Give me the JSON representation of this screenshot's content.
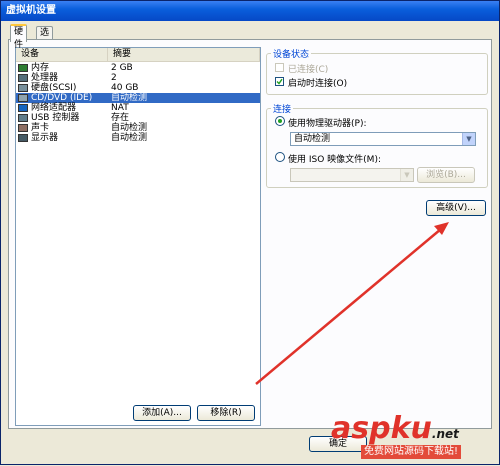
{
  "window": {
    "title": "虚拟机设置"
  },
  "tabs": [
    {
      "label": "硬件",
      "active": true
    },
    {
      "label": "选项",
      "active": false
    }
  ],
  "device_list": {
    "columns": [
      "设备",
      "摘要"
    ],
    "rows": [
      {
        "device": "内存",
        "summary": "2 GB",
        "icon": "memory-icon"
      },
      {
        "device": "处理器",
        "summary": "2",
        "icon": "processor-icon"
      },
      {
        "device": "硬盘(SCSI)",
        "summary": "40 GB",
        "icon": "hard-disk-icon"
      },
      {
        "device": "CD/DVD (IDE)",
        "summary": "自动检测",
        "icon": "cd-dvd-icon",
        "selected": true
      },
      {
        "device": "网络适配器",
        "summary": "NAT",
        "icon": "network-adapter-icon"
      },
      {
        "device": "USB 控制器",
        "summary": "存在",
        "icon": "usb-controller-icon"
      },
      {
        "device": "声卡",
        "summary": "自动检测",
        "icon": "sound-card-icon"
      },
      {
        "device": "显示器",
        "summary": "自动检测",
        "icon": "display-icon"
      }
    ],
    "add_button": "添加(A)...",
    "remove_button": "移除(R)"
  },
  "device_status": {
    "title": "设备状态",
    "connected": {
      "label": "已连接(C)",
      "checked": false,
      "enabled": false
    },
    "connect_at_power_on": {
      "label": "启动时连接(O)",
      "checked": true,
      "enabled": true
    }
  },
  "connection": {
    "title": "连接",
    "use_physical": {
      "label": "使用物理驱动器(P):",
      "selected": true
    },
    "physical_value": "自动检测",
    "use_iso": {
      "label": "使用 ISO 映像文件(M):",
      "selected": false
    },
    "iso_value": "",
    "browse_button": "浏览(B)..."
  },
  "advanced_button": "高级(V)...",
  "footer": {
    "ok_button": "确定"
  },
  "watermark": {
    "text": "aspku",
    "tld": ".net",
    "subtitle": "免费网站源码下载站!"
  },
  "colors": {
    "selection": "#316ac5",
    "title_blue": "#0a5fdc",
    "arrow_red": "#e0322a",
    "group_label": "#0046d5"
  }
}
